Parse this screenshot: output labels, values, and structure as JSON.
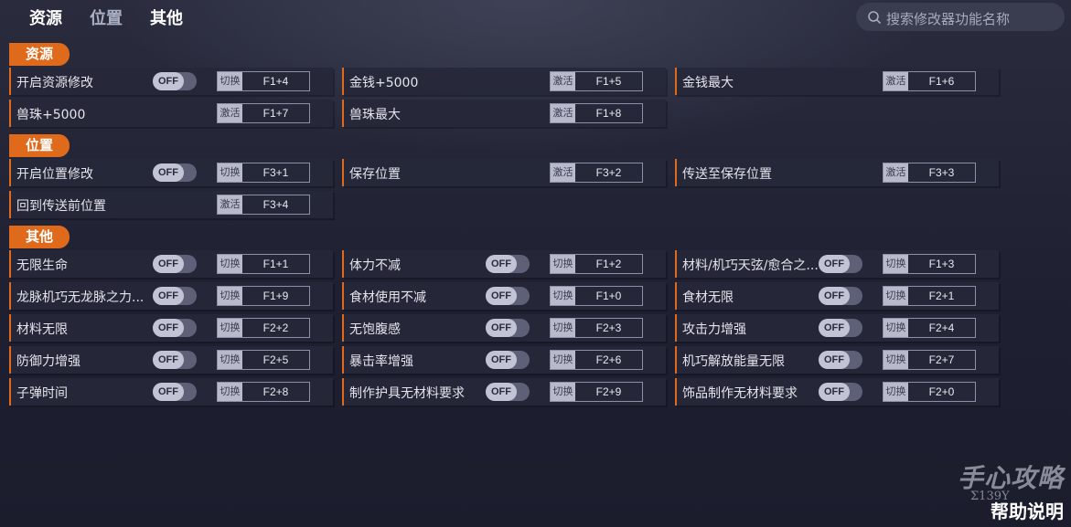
{
  "tabs": [
    {
      "label": "资源",
      "active": true
    },
    {
      "label": "位置",
      "active": false
    },
    {
      "label": "其他",
      "active": false
    }
  ],
  "search": {
    "placeholder": "搜索修改器功能名称"
  },
  "sections": [
    {
      "title": "资源",
      "items": [
        {
          "label": "开启资源修改",
          "toggle": "OFF",
          "action": "切换",
          "hotkey": "F1+4"
        },
        {
          "label": "金钱+5000",
          "toggle": null,
          "action": "激活",
          "hotkey": "F1+5"
        },
        {
          "label": "金钱最大",
          "toggle": null,
          "action": "激活",
          "hotkey": "F1+6"
        },
        {
          "label": "兽珠+5000",
          "toggle": null,
          "action": "激活",
          "hotkey": "F1+7"
        },
        {
          "label": "兽珠最大",
          "toggle": null,
          "action": "激活",
          "hotkey": "F1+8"
        }
      ]
    },
    {
      "title": "位置",
      "items": [
        {
          "label": "开启位置修改",
          "toggle": "OFF",
          "action": "切换",
          "hotkey": "F3+1"
        },
        {
          "label": "保存位置",
          "toggle": null,
          "action": "激活",
          "hotkey": "F3+2"
        },
        {
          "label": "传送至保存位置",
          "toggle": null,
          "action": "激活",
          "hotkey": "F3+3"
        },
        {
          "label": "回到传送前位置",
          "toggle": null,
          "action": "激活",
          "hotkey": "F3+4"
        }
      ]
    },
    {
      "title": "其他",
      "items": [
        {
          "label": "无限生命",
          "toggle": "OFF",
          "action": "切换",
          "hotkey": "F1+1"
        },
        {
          "label": "体力不减",
          "toggle": "OFF",
          "action": "切换",
          "hotkey": "F1+2"
        },
        {
          "label": "材料/机巧天弦/愈合之...",
          "toggle": "OFF",
          "action": "切换",
          "hotkey": "F1+3"
        },
        {
          "label": "龙脉机巧无龙脉之力...",
          "toggle": "OFF",
          "action": "切换",
          "hotkey": "F1+9"
        },
        {
          "label": "食材使用不减",
          "toggle": "OFF",
          "action": "切换",
          "hotkey": "F1+0"
        },
        {
          "label": "食材无限",
          "toggle": "OFF",
          "action": "切换",
          "hotkey": "F2+1"
        },
        {
          "label": "材料无限",
          "toggle": "OFF",
          "action": "切换",
          "hotkey": "F2+2"
        },
        {
          "label": "无饱腹感",
          "toggle": "OFF",
          "action": "切换",
          "hotkey": "F2+3"
        },
        {
          "label": "攻击力增强",
          "toggle": "OFF",
          "action": "切换",
          "hotkey": "F2+4"
        },
        {
          "label": "防御力增强",
          "toggle": "OFF",
          "action": "切换",
          "hotkey": "F2+5"
        },
        {
          "label": "暴击率增强",
          "toggle": "OFF",
          "action": "切换",
          "hotkey": "F2+6"
        },
        {
          "label": "机巧解放能量无限",
          "toggle": "OFF",
          "action": "切换",
          "hotkey": "F2+7"
        },
        {
          "label": "子弹时间",
          "toggle": "OFF",
          "action": "切换",
          "hotkey": "F2+8"
        },
        {
          "label": "制作护具无材料要求",
          "toggle": "OFF",
          "action": "切换",
          "hotkey": "F2+9"
        },
        {
          "label": "饰品制作无材料要求",
          "toggle": "OFF",
          "action": "切换",
          "hotkey": "F2+0"
        }
      ]
    }
  ],
  "branding": {
    "logo": "手心攻略",
    "url": "Σ139Y",
    "help": "帮助说明"
  },
  "colors": {
    "accent": "#e06a1c",
    "background": "#1e2032",
    "row": "#26283a"
  }
}
